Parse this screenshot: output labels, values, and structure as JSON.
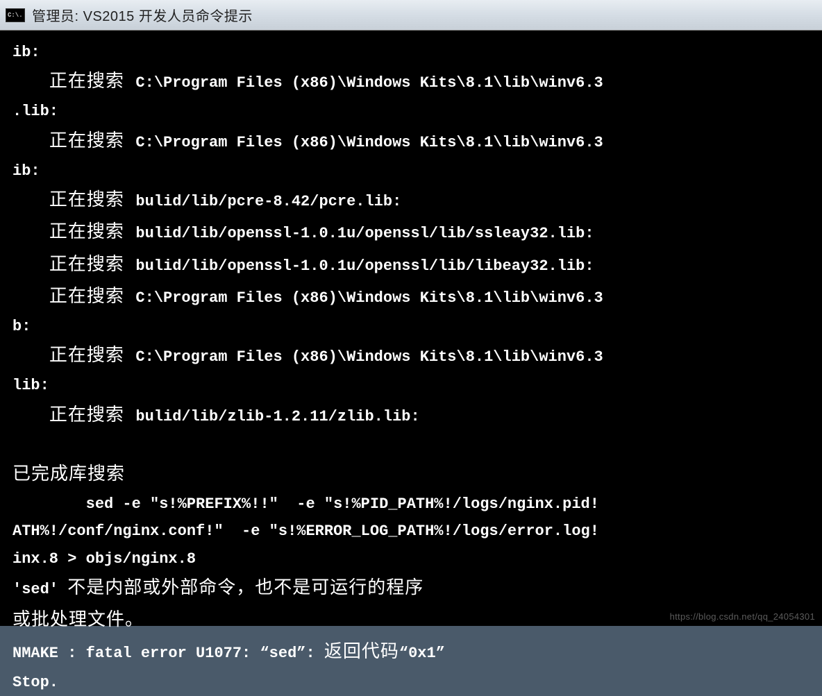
{
  "window": {
    "icon_text": "C:\\.",
    "title": "管理员: VS2015 开发人员命令提示"
  },
  "terminal": {
    "lines": [
      {
        "indent": "",
        "prefix": "",
        "text": "ib:"
      },
      {
        "indent": "    ",
        "prefix": "正在搜索 ",
        "text": "C:\\Program Files (x86)\\Windows Kits\\8.1\\lib\\winv6.3"
      },
      {
        "indent": "",
        "prefix": "",
        "text": ".lib:"
      },
      {
        "indent": "    ",
        "prefix": "正在搜索 ",
        "text": "C:\\Program Files (x86)\\Windows Kits\\8.1\\lib\\winv6.3"
      },
      {
        "indent": "",
        "prefix": "",
        "text": "ib:"
      },
      {
        "indent": "    ",
        "prefix": "正在搜索 ",
        "text": "bulid/lib/pcre-8.42/pcre.lib:"
      },
      {
        "indent": "    ",
        "prefix": "正在搜索 ",
        "text": "bulid/lib/openssl-1.0.1u/openssl/lib/ssleay32.lib:"
      },
      {
        "indent": "    ",
        "prefix": "正在搜索 ",
        "text": "bulid/lib/openssl-1.0.1u/openssl/lib/libeay32.lib:"
      },
      {
        "indent": "    ",
        "prefix": "正在搜索 ",
        "text": "C:\\Program Files (x86)\\Windows Kits\\8.1\\lib\\winv6.3"
      },
      {
        "indent": "",
        "prefix": "",
        "text": "b:"
      },
      {
        "indent": "    ",
        "prefix": "正在搜索 ",
        "text": "C:\\Program Files (x86)\\Windows Kits\\8.1\\lib\\winv6.3"
      },
      {
        "indent": "",
        "prefix": "",
        "text": "lib:"
      },
      {
        "indent": "    ",
        "prefix": "正在搜索 ",
        "text": "bulid/lib/zlib-1.2.11/zlib.lib:"
      },
      {
        "indent": "",
        "prefix": "",
        "text": ""
      },
      {
        "indent": "",
        "prefix": "已完成库搜索",
        "text": ""
      },
      {
        "indent": "",
        "prefix": "",
        "text": "        sed -e \"s!%PREFIX%!!\"  -e \"s!%PID_PATH%!/logs/nginx.pid!"
      },
      {
        "indent": "",
        "prefix": "",
        "text": "ATH%!/conf/nginx.conf!\"  -e \"s!%ERROR_LOG_PATH%!/logs/error.log!"
      },
      {
        "indent": "",
        "prefix": "",
        "text": "inx.8 > objs/nginx.8"
      },
      {
        "indent": "",
        "prefix_mono": "'sed' ",
        "prefix": "不是内部或外部命令，也不是可运行的程序",
        "text": ""
      },
      {
        "indent": "",
        "prefix": "或批处理文件。",
        "text": ""
      },
      {
        "indent": "",
        "prefix": "",
        "text_mix": [
          {
            "t": "mono",
            "v": "NMAKE : fatal error U1077: “sed”: "
          },
          {
            "t": "cjk",
            "v": "返回代码"
          },
          {
            "t": "mono",
            "v": "“0x1”"
          }
        ]
      },
      {
        "indent": "",
        "prefix": "",
        "text": "Stop."
      }
    ]
  },
  "watermark": "https://blog.csdn.net/qq_24054301"
}
